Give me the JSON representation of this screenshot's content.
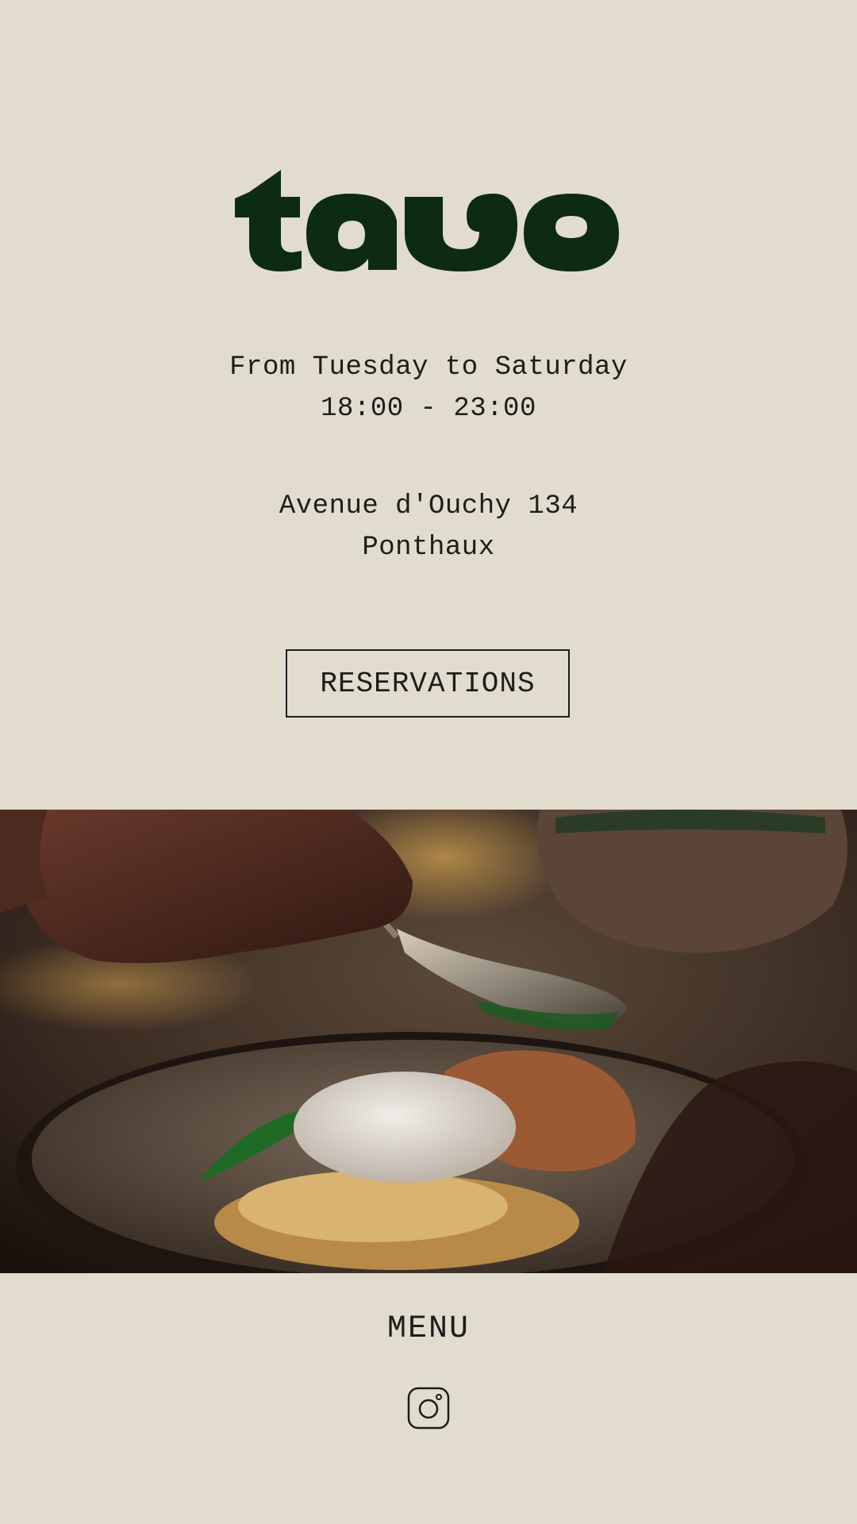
{
  "brand": {
    "name": "tavo",
    "logo_color": "#0d2a12"
  },
  "hours": {
    "days": "From Tuesday to Saturday",
    "time": "18:00 - 23:00"
  },
  "address": {
    "street": "Avenue d'Ouchy 134",
    "city": "Ponthaux"
  },
  "buttons": {
    "reservations": "RESERVATIONS"
  },
  "hero": {
    "icon": "food-photo-image"
  },
  "footer": {
    "menu_label": "MENU",
    "social_icon": "instagram-icon"
  },
  "colors": {
    "background": "#e1dccd",
    "text": "#1d1d1b"
  }
}
